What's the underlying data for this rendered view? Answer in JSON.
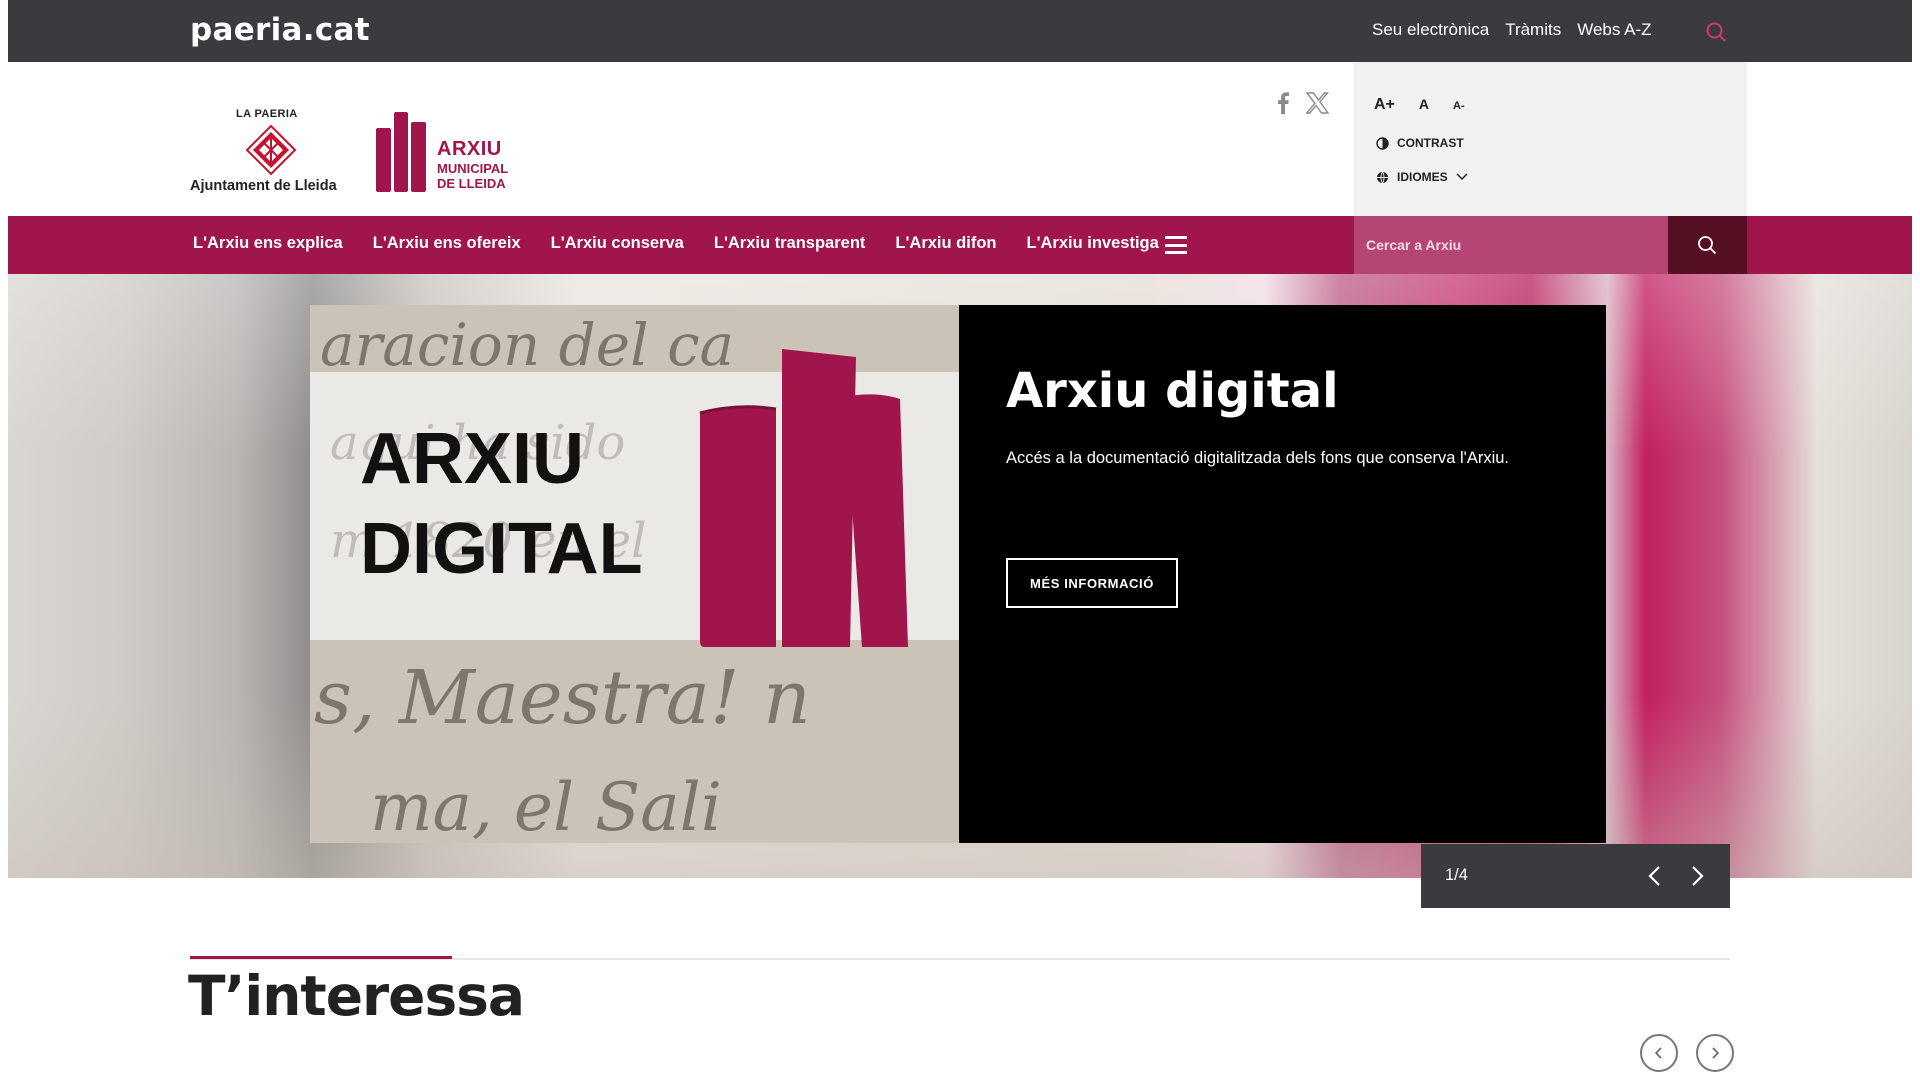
{
  "topbar": {
    "site_name": "paeria.cat",
    "links": [
      "Seu electrònica",
      "Tràmits",
      "Webs A-Z"
    ],
    "search_icon": "search-icon"
  },
  "logos": {
    "paeria_top": "LA PAERIA",
    "paeria_bottom": "Ajuntament de Lleida",
    "arxiu_title": "ARXIU",
    "arxiu_sub1": "MUNICIPAL",
    "arxiu_sub2": "DE LLEIDA"
  },
  "social": [
    "facebook-icon",
    "x-icon"
  ],
  "accessibility": {
    "size_increase": "A+",
    "size_normal": "A",
    "size_decrease": "A-",
    "contrast_label": "CONTRAST",
    "languages_label": "IDIOMES"
  },
  "nav": {
    "items": [
      "L'Arxiu ens explica",
      "L'Arxiu ens ofereix",
      "L'Arxiu conserva",
      "L'Arxiu transparent",
      "L'Arxiu difon",
      "L'Arxiu investiga"
    ],
    "menu_icon": "hamburger-menu-icon"
  },
  "search": {
    "placeholder": "Cercar a Arxiu"
  },
  "slide": {
    "image_text_line1": "ARXIU",
    "image_text_line2": "DIGITAL",
    "title": "Arxiu digital",
    "description": "Accés a la documentació digitalitzada dels fons que conserva l'Arxiu.",
    "button_label": "MÉS INFORMACIÓ",
    "counter": "1/4"
  },
  "section": {
    "title": "T’interessa"
  },
  "colors": {
    "brand": "#a0154c",
    "topbar": "#3b3a3f",
    "search_button": "#561023"
  }
}
